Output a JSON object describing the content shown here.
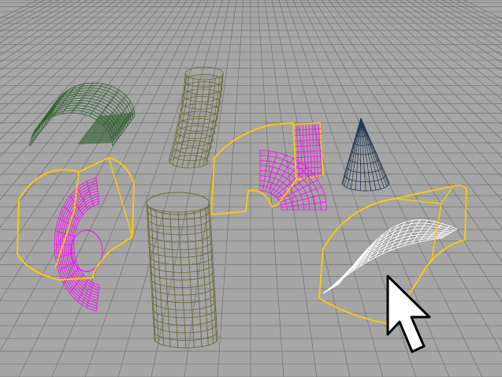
{
  "viewport": {
    "colors": {
      "background": "#a6a6a6",
      "grid_line": "#777777",
      "selection_cage": "#ffcc00",
      "wireframe_green": "#2f5f2f",
      "wireframe_magenta": "#ff00ff",
      "wireframe_olive": "#6b6a3a",
      "wireframe_navy": "#1f3550",
      "wireframe_white": "#ffffff",
      "cursor_fill": "#ffffff",
      "cursor_stroke": "#000000"
    },
    "objects": [
      {
        "name": "green-half-cylinder",
        "color": "wireframe_green",
        "selected": false
      },
      {
        "name": "olive-bent-cylinder",
        "color": "wireframe_olive",
        "selected": false
      },
      {
        "name": "magenta-quarter-torus-left",
        "color": "wireframe_magenta",
        "selected": true
      },
      {
        "name": "magenta-box-with-arch",
        "color": "wireframe_magenta",
        "selected": true
      },
      {
        "name": "navy-cone",
        "color": "wireframe_navy",
        "selected": false
      },
      {
        "name": "tall-olive-cylinder",
        "color": "wireframe_olive",
        "selected": false
      },
      {
        "name": "white-curved-surface",
        "color": "wireframe_white",
        "selected": true
      }
    ],
    "cursor": {
      "icon": "arrow-cursor-icon"
    }
  }
}
